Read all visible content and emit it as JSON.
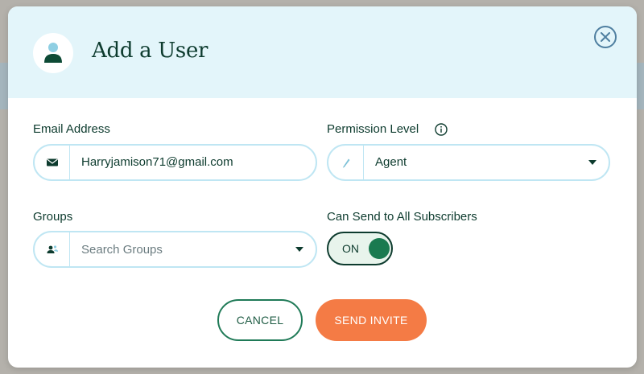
{
  "modal": {
    "title": "Add a User",
    "avatar_icon": "user-avatar-icon",
    "close_icon": "close-circle-icon"
  },
  "email": {
    "label": "Email Address",
    "value": "Harryjamison71@gmail.com",
    "icon": "envelope-icon"
  },
  "permission": {
    "label": "Permission Level",
    "selected": "Agent",
    "icon": "pencil-icon",
    "info_icon": "info-icon"
  },
  "groups": {
    "label": "Groups",
    "placeholder": "Search Groups",
    "icon": "user-group-icon"
  },
  "send_all": {
    "label": "Can Send to All Subscribers",
    "state": "ON",
    "on": true
  },
  "actions": {
    "cancel_label": "CANCEL",
    "invite_label": "SEND INVITE"
  },
  "colors": {
    "header_bg": "#e3f5fa",
    "primary_dark": "#0d3b2e",
    "accent_green": "#1a7a50",
    "cta_orange": "#f47b45",
    "input_border": "#bfe6f3"
  }
}
